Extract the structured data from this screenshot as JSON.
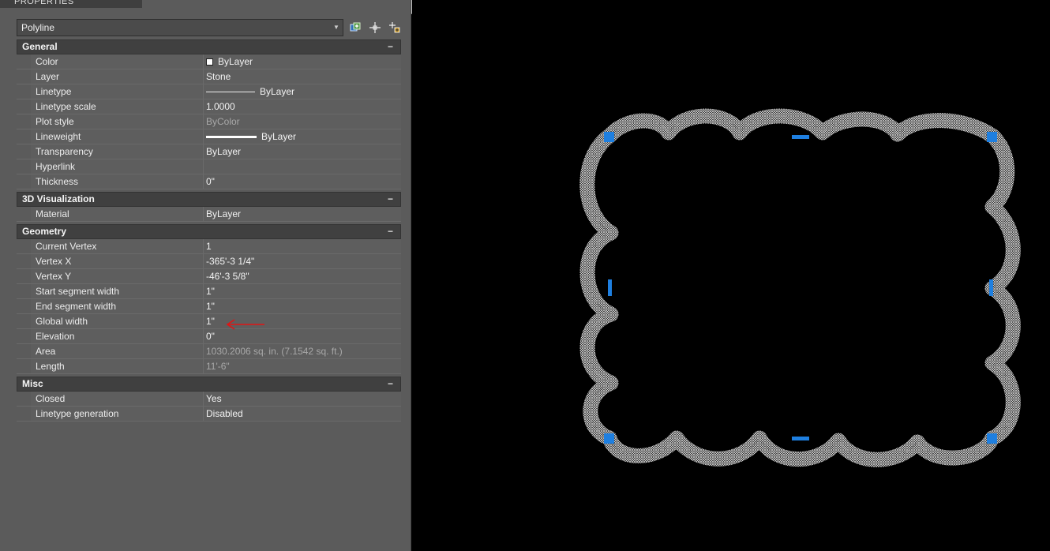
{
  "palette": {
    "title": "PROPERTIES",
    "selected_object": "Polyline"
  },
  "sections": [
    {
      "name": "General",
      "collapse_glyph": "−",
      "rows": [
        {
          "label": "Color",
          "value": "ByLayer",
          "kind": "color"
        },
        {
          "label": "Layer",
          "value": "Stone"
        },
        {
          "label": "Linetype",
          "value": "ByLayer",
          "kind": "linetype"
        },
        {
          "label": "Linetype scale",
          "value": "1.0000"
        },
        {
          "label": "Plot style",
          "value": "ByColor",
          "dim": true
        },
        {
          "label": "Lineweight",
          "value": "ByLayer",
          "kind": "lineweight"
        },
        {
          "label": "Transparency",
          "value": "ByLayer"
        },
        {
          "label": "Hyperlink",
          "value": ""
        },
        {
          "label": "Thickness",
          "value": "0\""
        }
      ]
    },
    {
      "name": "3D Visualization",
      "collapse_glyph": "−",
      "rows": [
        {
          "label": "Material",
          "value": "ByLayer"
        }
      ]
    },
    {
      "name": "Geometry",
      "collapse_glyph": "−",
      "rows": [
        {
          "label": "Current Vertex",
          "value": "1"
        },
        {
          "label": "Vertex X",
          "value": "-365'-3 1/4\""
        },
        {
          "label": "Vertex Y",
          "value": "-46'-3 5/8\""
        },
        {
          "label": "Start segment width",
          "value": "1\""
        },
        {
          "label": "End segment width",
          "value": "1\""
        },
        {
          "label": "Global width",
          "value": "1\""
        },
        {
          "label": "Elevation",
          "value": "0\""
        },
        {
          "label": "Area",
          "value": "1030.2006 sq. in. (7.1542 sq. ft.)",
          "dim": true
        },
        {
          "label": "Length",
          "value": "11'-6\"",
          "dim": true
        }
      ]
    },
    {
      "name": "Misc",
      "collapse_glyph": "−",
      "rows": [
        {
          "label": "Closed",
          "value": "Yes"
        },
        {
          "label": "Linetype generation",
          "value": "Disabled"
        }
      ]
    }
  ],
  "colors": {
    "palette_bg": "#5b5b5b",
    "header_bg": "#404040",
    "grip_blue": "#1e7fe0",
    "annotation_red": "#e01515",
    "hatch": "#cfcfcf"
  },
  "toolbar_icons": [
    "ortho-icon",
    "perpendicular-icon",
    "intersection-icon",
    "extension-icon",
    "apparent-icon",
    "midpoint-icon",
    "nearest-icon",
    "node-icon",
    "parallel-icon",
    "quadrant-icon",
    "tangent-icon",
    "insert-icon",
    "arc-icon",
    "box-icon",
    "center-icon",
    "circle-icon",
    "edit-icon",
    "pencil-icon",
    "layers-icon"
  ]
}
